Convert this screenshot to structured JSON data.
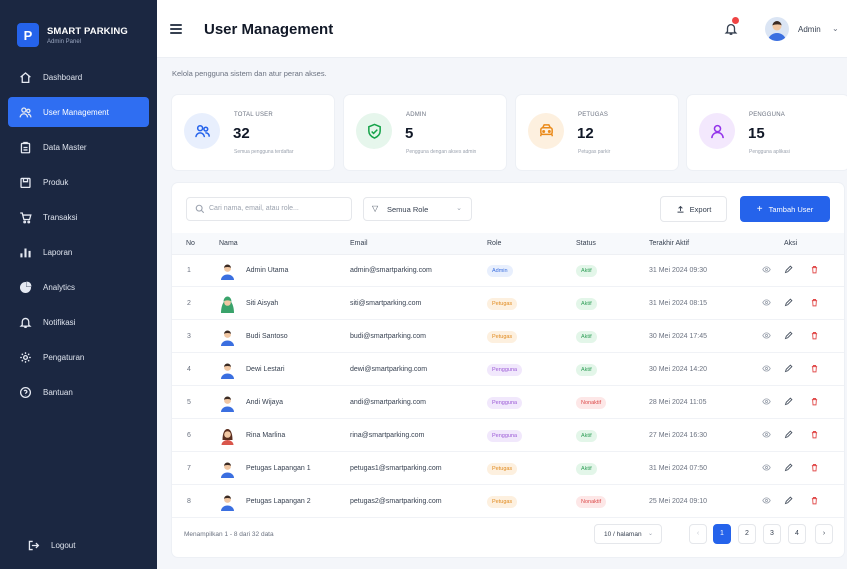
{
  "brand": {
    "logo_letter": "P",
    "title": "SMART PARKING",
    "subtitle": "Admin Panel"
  },
  "sidebar": {
    "items": [
      {
        "label": "Dashboard",
        "icon": "home-icon",
        "active": false
      },
      {
        "label": "User Management",
        "icon": "users-icon",
        "active": true
      },
      {
        "label": "Data Master",
        "icon": "clipboard-icon",
        "active": false
      },
      {
        "label": "Produk",
        "icon": "box-icon",
        "active": false
      },
      {
        "label": "Transaksi",
        "icon": "cart-icon",
        "active": false
      },
      {
        "label": "Laporan",
        "icon": "bar-chart-icon",
        "active": false
      },
      {
        "label": "Analytics",
        "icon": "pie-chart-icon",
        "active": false
      },
      {
        "label": "Notifikasi",
        "icon": "bell-icon",
        "active": false
      },
      {
        "label": "Pengaturan",
        "icon": "gear-icon",
        "active": false
      },
      {
        "label": "Bantuan",
        "icon": "help-icon",
        "active": false
      }
    ],
    "logout_label": "Logout"
  },
  "header": {
    "title": "User Management",
    "user_name": "Admin",
    "notification_badge": ""
  },
  "subtitle": "Kelola pengguna sistem dan atur peran akses.",
  "stats": [
    {
      "label": "TOTAL USER",
      "value": "32",
      "desc": "Semua pengguna terdaftar",
      "color": "#2563eb",
      "bg": "#e8effd"
    },
    {
      "label": "ADMIN",
      "value": "5",
      "desc": "Pengguna dengan akses admin",
      "color": "#16a34a",
      "bg": "#e6f6ec"
    },
    {
      "label": "PETUGAS",
      "value": "12",
      "desc": "Petugas parkir",
      "color": "#ea8a1a",
      "bg": "#fdf0df"
    },
    {
      "label": "PENGGUNA",
      "value": "15",
      "desc": "Pengguna aplikasi",
      "color": "#9333ea",
      "bg": "#f3e8fd"
    }
  ],
  "toolbar": {
    "search_placeholder": "Cari nama, email, atau role...",
    "role_filter": "Semua Role",
    "export_label": "Export",
    "add_label": "Tambah User"
  },
  "table": {
    "headers": {
      "no": "No",
      "nama": "Nama",
      "email": "Email",
      "role": "Role",
      "status": "Status",
      "last_active": "Terakhir Aktif",
      "aksi": "Aksi"
    },
    "rows": [
      {
        "no": "1",
        "nama": "Admin Utama",
        "email": "admin@smartparking.com",
        "role": "Admin",
        "status": "Aktif",
        "last_active": "31 Mei 2024 09:30",
        "avatar": "male"
      },
      {
        "no": "2",
        "nama": "Siti Aisyah",
        "email": "siti@smartparking.com",
        "role": "Petugas",
        "status": "Aktif",
        "last_active": "31 Mei 2024 08:15",
        "avatar": "hijab"
      },
      {
        "no": "3",
        "nama": "Budi Santoso",
        "email": "budi@smartparking.com",
        "role": "Petugas",
        "status": "Aktif",
        "last_active": "30 Mei 2024 17:45",
        "avatar": "male"
      },
      {
        "no": "4",
        "nama": "Dewi Lestari",
        "email": "dewi@smartparking.com",
        "role": "Pengguna",
        "status": "Aktif",
        "last_active": "30 Mei 2024 14:20",
        "avatar": "male"
      },
      {
        "no": "5",
        "nama": "Andi Wijaya",
        "email": "andi@smartparking.com",
        "role": "Pengguna",
        "status": "Nonaktif",
        "last_active": "28 Mei 2024 11:05",
        "avatar": "male"
      },
      {
        "no": "6",
        "nama": "Rina Marlina",
        "email": "rina@smartparking.com",
        "role": "Pengguna",
        "status": "Aktif",
        "last_active": "27 Mei 2024 16:30",
        "avatar": "female"
      },
      {
        "no": "7",
        "nama": "Petugas Lapangan 1",
        "email": "petugas1@smartparking.com",
        "role": "Petugas",
        "status": "Aktif",
        "last_active": "31 Mei 2024 07:50",
        "avatar": "male"
      },
      {
        "no": "8",
        "nama": "Petugas Lapangan 2",
        "email": "petugas2@smartparking.com",
        "role": "Petugas",
        "status": "Nonaktif",
        "last_active": "25 Mei 2024 09:10",
        "avatar": "male"
      }
    ]
  },
  "badge_colors": {
    "Admin": {
      "bg": "#e8effd",
      "fg": "#3b6fe0"
    },
    "Petugas": {
      "bg": "#fdf0df",
      "fg": "#e08a1e"
    },
    "Pengguna": {
      "bg": "#f1e8fc",
      "fg": "#9b59d6"
    },
    "Aktif": {
      "bg": "#e3f6e9",
      "fg": "#2f9e57"
    },
    "Nonaktif": {
      "bg": "#fde7e7",
      "fg": "#dc4c4c"
    }
  },
  "footer": {
    "info": "Menampilkan 1 - 8 dari 32 data",
    "per_page": "10 / halaman",
    "pages": [
      "1",
      "2",
      "3",
      "4"
    ],
    "current_page": "1"
  }
}
